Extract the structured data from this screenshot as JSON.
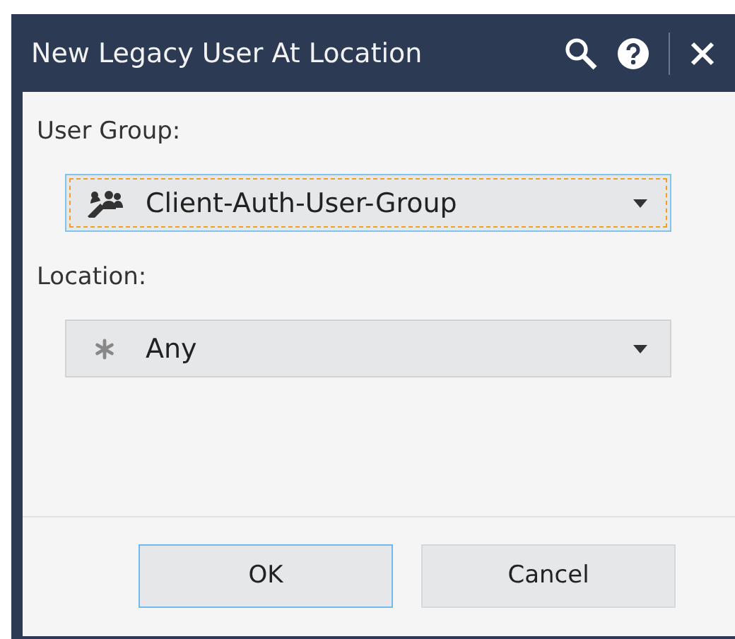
{
  "window": {
    "title": "New Legacy User At Location"
  },
  "fields": [
    {
      "label": "User Group:",
      "value": "Client-Auth-User-Group",
      "kind": "group",
      "focused": true
    },
    {
      "label": "Location:",
      "value": "Any",
      "kind": "any",
      "focused": false
    }
  ],
  "buttons": [
    {
      "label": "OK",
      "default": true
    },
    {
      "label": "Cancel",
      "default": false
    }
  ]
}
